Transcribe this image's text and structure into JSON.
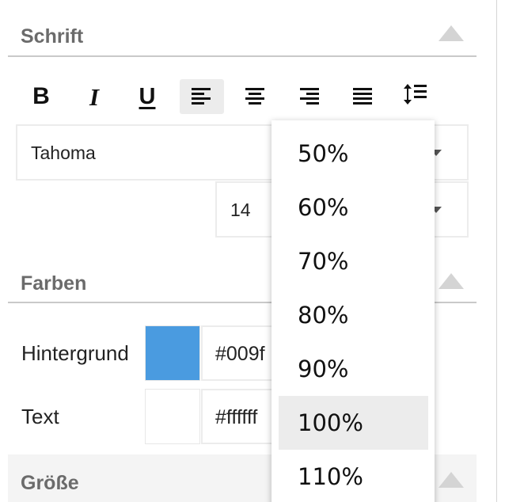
{
  "sections": {
    "font": {
      "title": "Schrift"
    },
    "colors": {
      "title": "Farben"
    },
    "size": {
      "title": "Größe"
    }
  },
  "toolbar": {
    "bold": "B",
    "italic": "I",
    "underline": "U",
    "active": "align-left"
  },
  "font_family": {
    "value": "Tahoma"
  },
  "font_size": {
    "value": "14"
  },
  "colors": {
    "background": {
      "label": "Hintergrund",
      "hex": "#009f",
      "swatch": "#4a9be0"
    },
    "text": {
      "label": "Text",
      "hex": "#ffffff",
      "swatch": "#ffffff"
    }
  },
  "zoom_dropdown": {
    "options": [
      "50%",
      "60%",
      "70%",
      "80%",
      "90%",
      "100%",
      "110%"
    ],
    "selected": "100%"
  }
}
